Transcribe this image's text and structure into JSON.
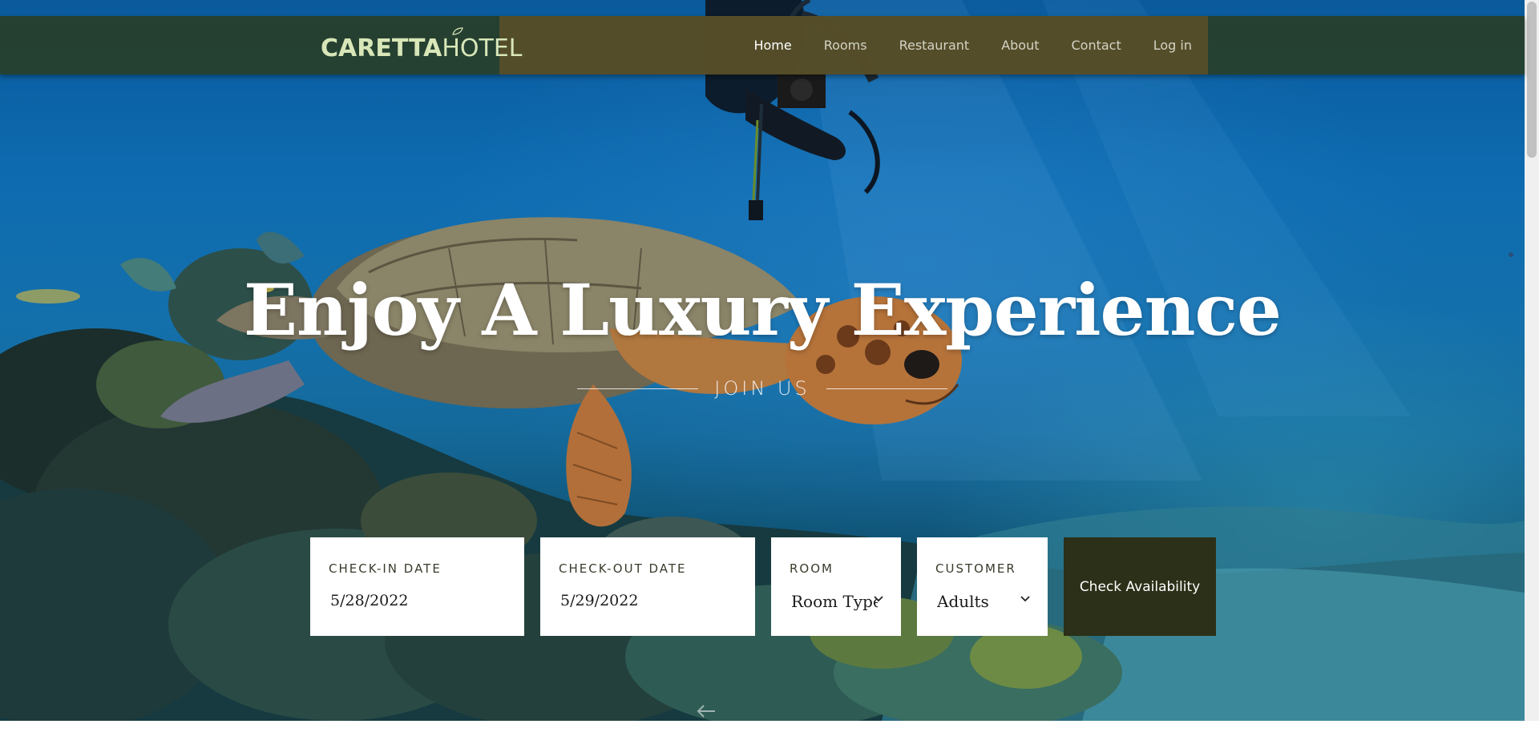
{
  "brand": {
    "logo_bold": "CARETTA",
    "logo_light": "HOTEL"
  },
  "nav": {
    "items": [
      {
        "label": "Home",
        "active": true
      },
      {
        "label": "Rooms",
        "active": false
      },
      {
        "label": "Restaurant",
        "active": false
      },
      {
        "label": "About",
        "active": false
      },
      {
        "label": "Contact",
        "active": false
      },
      {
        "label": "Log in",
        "active": false
      }
    ]
  },
  "hero": {
    "title": "Enjoy A Luxury Experience",
    "subtitle": "JOIN US"
  },
  "booking": {
    "checkin": {
      "label": "CHECK-IN DATE",
      "value": "5/28/2022"
    },
    "checkout": {
      "label": "CHECK-OUT DATE",
      "value": "5/29/2022"
    },
    "room": {
      "label": "ROOM",
      "value": "Room Type"
    },
    "customer": {
      "label": "CUSTOMER",
      "value": "Adults"
    },
    "submit_label": "Check Availability"
  },
  "colors": {
    "nav_bg": "#283e28",
    "nav_accent": "#5b4f28",
    "logo": "#d8e6b8",
    "button_bg": "#2c3018"
  },
  "icons": [
    "chevron-down-icon",
    "arrow-left-icon",
    "leaf-icon"
  ]
}
